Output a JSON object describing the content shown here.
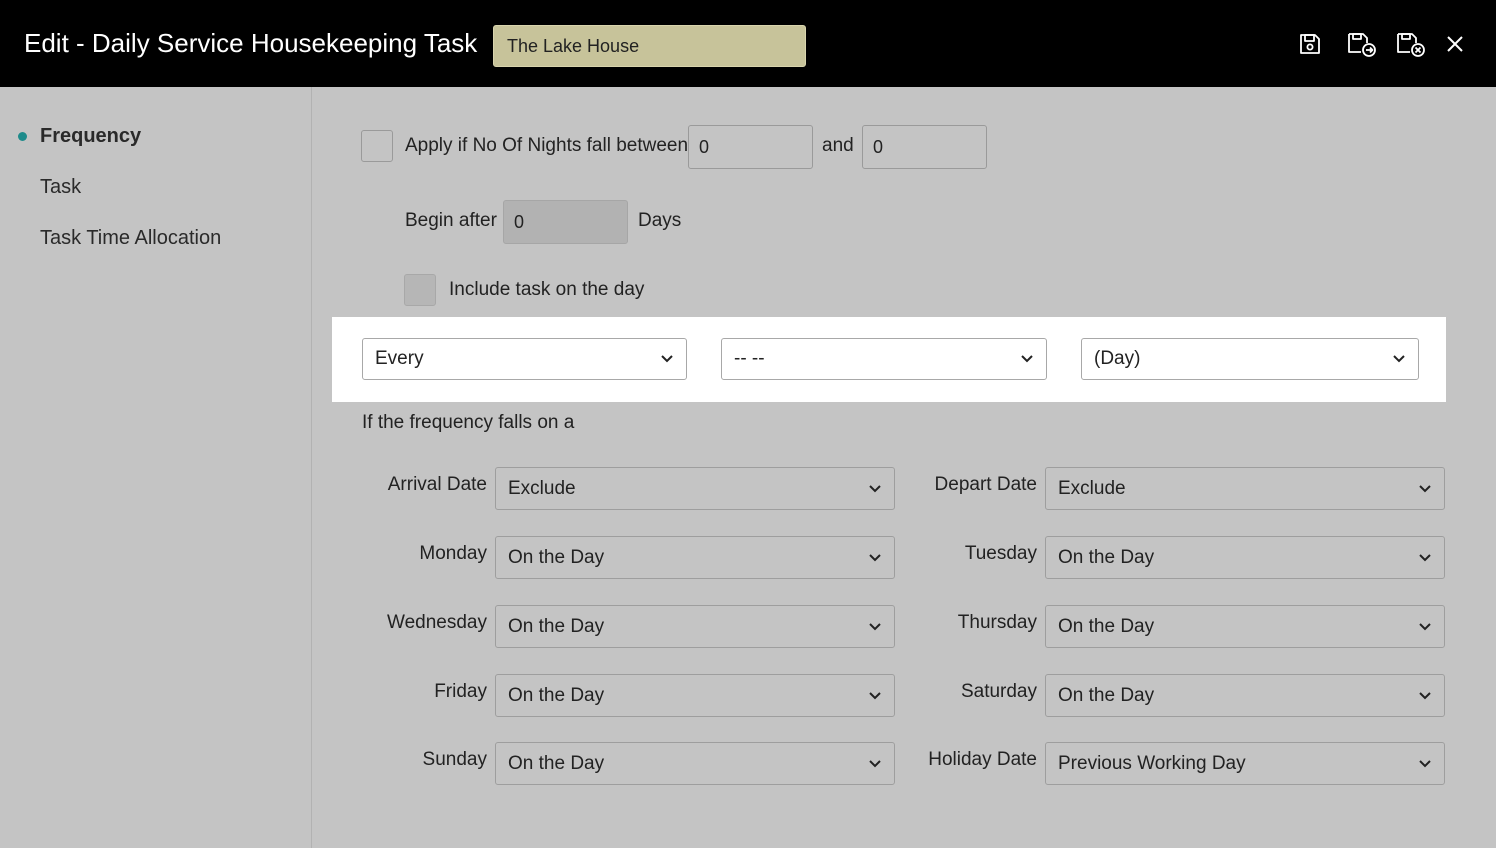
{
  "header": {
    "title": "Edit - Daily Service Housekeeping Task",
    "property_name": "The Lake House",
    "icons": [
      "save-icon",
      "save-and-new-icon",
      "save-and-close-icon",
      "close-icon"
    ]
  },
  "sidebar": {
    "items": [
      {
        "label": "Frequency",
        "active": true
      },
      {
        "label": "Task",
        "active": false
      },
      {
        "label": "Task Time Allocation",
        "active": false
      }
    ]
  },
  "form": {
    "nights_label": "Apply if No Of Nights fall between",
    "nights_from": "0",
    "and_label": "and",
    "nights_to": "0",
    "begin_after_label": "Begin after",
    "begin_after_value": "0",
    "days_label": "Days",
    "include_task_label": "Include task on the day",
    "frequency": {
      "every": "Every",
      "interval": "-- --",
      "unit": "(Day)"
    },
    "falls_on_label": "If the frequency falls on a",
    "rules": [
      {
        "label": "Arrival Date",
        "value": "Exclude"
      },
      {
        "label": "Depart Date",
        "value": "Exclude"
      },
      {
        "label": "Monday",
        "value": "On the Day"
      },
      {
        "label": "Tuesday",
        "value": "On the Day"
      },
      {
        "label": "Wednesday",
        "value": "On the Day"
      },
      {
        "label": "Thursday",
        "value": "On the Day"
      },
      {
        "label": "Friday",
        "value": "On the Day"
      },
      {
        "label": "Saturday",
        "value": "On the Day"
      },
      {
        "label": "Sunday",
        "value": "On the Day"
      },
      {
        "label": "Holiday Date",
        "value": "Previous Working Day"
      }
    ]
  },
  "colors": {
    "header_bg": "#000000",
    "page_bg": "#c4c4c4",
    "property_bg": "#c7c39a",
    "active_dot": "#1e8b8b"
  }
}
